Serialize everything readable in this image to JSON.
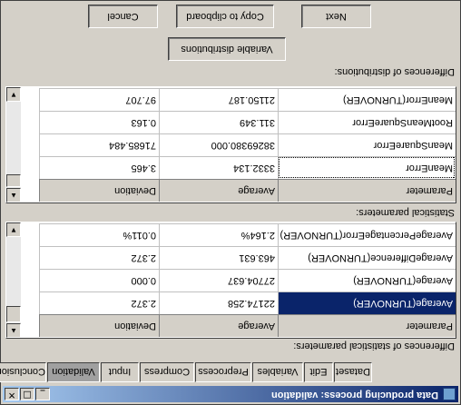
{
  "title_bar": {
    "title": "Data producing process: validation",
    "minimize": "_",
    "maximize": "□",
    "close": "✕",
    "icon": "app-icon"
  },
  "tabs": [
    "Dataset",
    "Edit",
    "Variables",
    "Preprocess",
    "Compress",
    "Input",
    "Validation",
    "Conclusion"
  ],
  "active_tab": "Validation",
  "stat_section": {
    "label": "Differences of statistical parameters:",
    "headers": [
      "Parameter",
      "Average",
      "Deviation"
    ],
    "rows": [
      [
        "Average(TURNOVER)",
        "22174.258",
        "2.372"
      ],
      [
        "Average(TURNOVER)",
        "27704.637",
        "0.000"
      ],
      [
        "AverageDifference(TURNOVER)",
        "463.631",
        "2.372"
      ],
      [
        "AveragePercentageError(TURNOVER)",
        "2.164%",
        "0.011%"
      ]
    ],
    "footer_label": "Statistical parameters:"
  },
  "dist_section": {
    "label": "Differences of distributions:",
    "headers": [
      "Parameter",
      "Average",
      "Deviation"
    ],
    "rows": [
      [
        "MeanError",
        "3332.134",
        "3.465"
      ],
      [
        "MeanSquareError",
        "38269380.000",
        "71685.484"
      ],
      [
        "RootMeanSquareError",
        "311.349",
        "0.163"
      ],
      [
        "MeanError(TURNOVER)",
        "21150.187",
        "97.707"
      ]
    ]
  },
  "buttons": {
    "variable_distributions": "Variable distributions",
    "cancel": "Cancel",
    "copy": "Copy to clipboard",
    "next": "Next"
  },
  "scroll_arrows": {
    "up": "▲",
    "down": "▼"
  }
}
